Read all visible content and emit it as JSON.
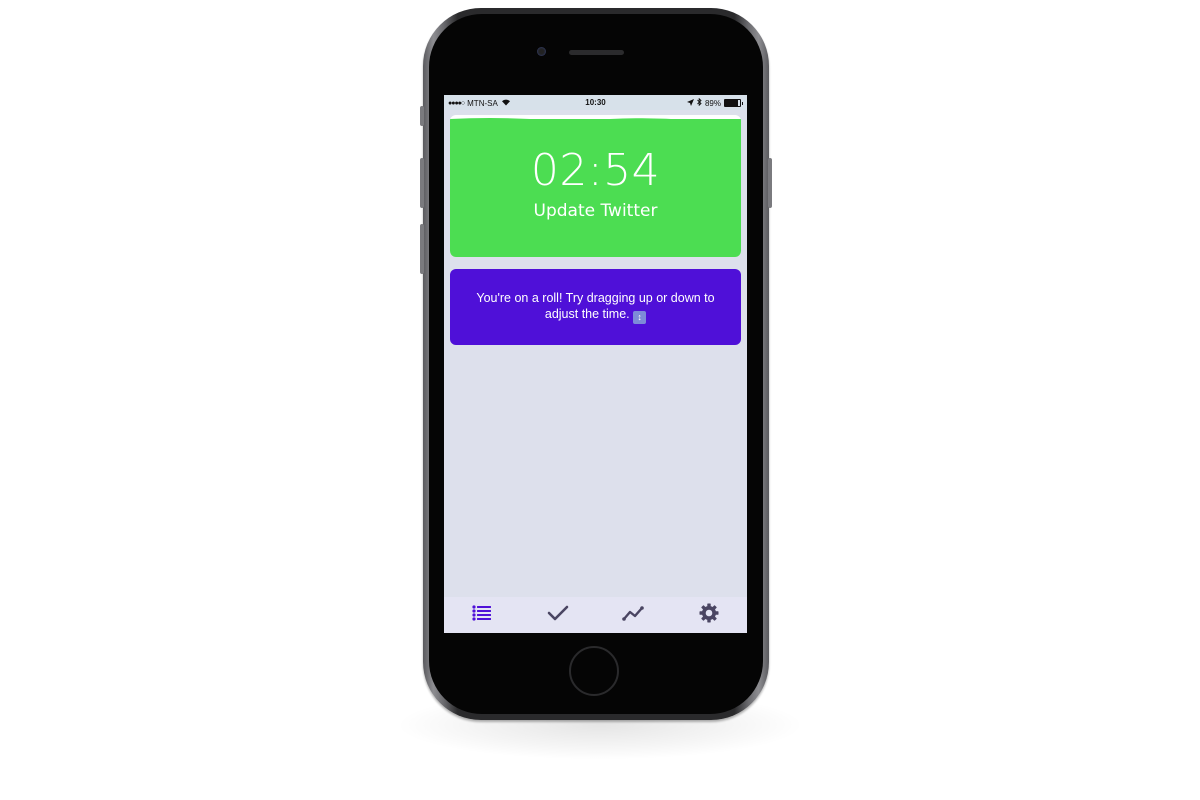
{
  "statusbar": {
    "signal": "●●●●○",
    "carrier": "MTN-SA",
    "time": "10:30",
    "battery_percent_label": "89%",
    "battery_level": 0.89
  },
  "timer": {
    "time": "02:54",
    "task": "Update Twitter",
    "progress": 0.97,
    "fill_color": "#4cdd52"
  },
  "tip": {
    "message": "You're on a roll! Try dragging up or down to adjust the time.",
    "emoji": "↕",
    "color": "#4f10d8"
  },
  "tabbar": {
    "active_color": "#4f10d8",
    "inactive_color": "#4a4562",
    "tabs": [
      {
        "name": "list",
        "icon": "list-icon",
        "active": true
      },
      {
        "name": "completed",
        "icon": "checkmark-icon",
        "active": false
      },
      {
        "name": "stats",
        "icon": "chart-line-icon",
        "active": false
      },
      {
        "name": "settings",
        "icon": "gear-icon",
        "active": false
      }
    ]
  }
}
